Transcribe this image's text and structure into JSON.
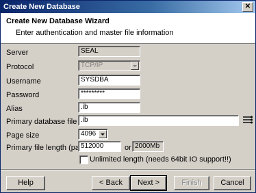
{
  "window": {
    "title": "Create New Database",
    "close_glyph": "✕"
  },
  "header": {
    "title": "Create New Database Wizard",
    "subtitle": "Enter authentication and master file information"
  },
  "form": {
    "server": {
      "label": "Server",
      "value": "SEAL"
    },
    "protocol": {
      "label": "Protocol",
      "value": "TCP/IP"
    },
    "username": {
      "label": "Username",
      "value": "SYSDBA"
    },
    "password": {
      "label": "Password",
      "value": "*********"
    },
    "alias": {
      "label": "Alias",
      "value": ".ib"
    },
    "primary_file": {
      "label": "Primary database file",
      "value": ".ib"
    },
    "page_size": {
      "label": "Page size",
      "value": "4096"
    },
    "file_length": {
      "label": "Primary file length (pages)",
      "value": "512000",
      "or_label": "or",
      "mb_value": "2000Mb"
    },
    "unlimited": {
      "label": "Unlimited length (needs 64bit IO support!!)",
      "checked": false
    }
  },
  "buttons": {
    "help": "Help",
    "back": "< Back",
    "next": "Next >",
    "finish": "Finish",
    "cancel": "Cancel"
  }
}
